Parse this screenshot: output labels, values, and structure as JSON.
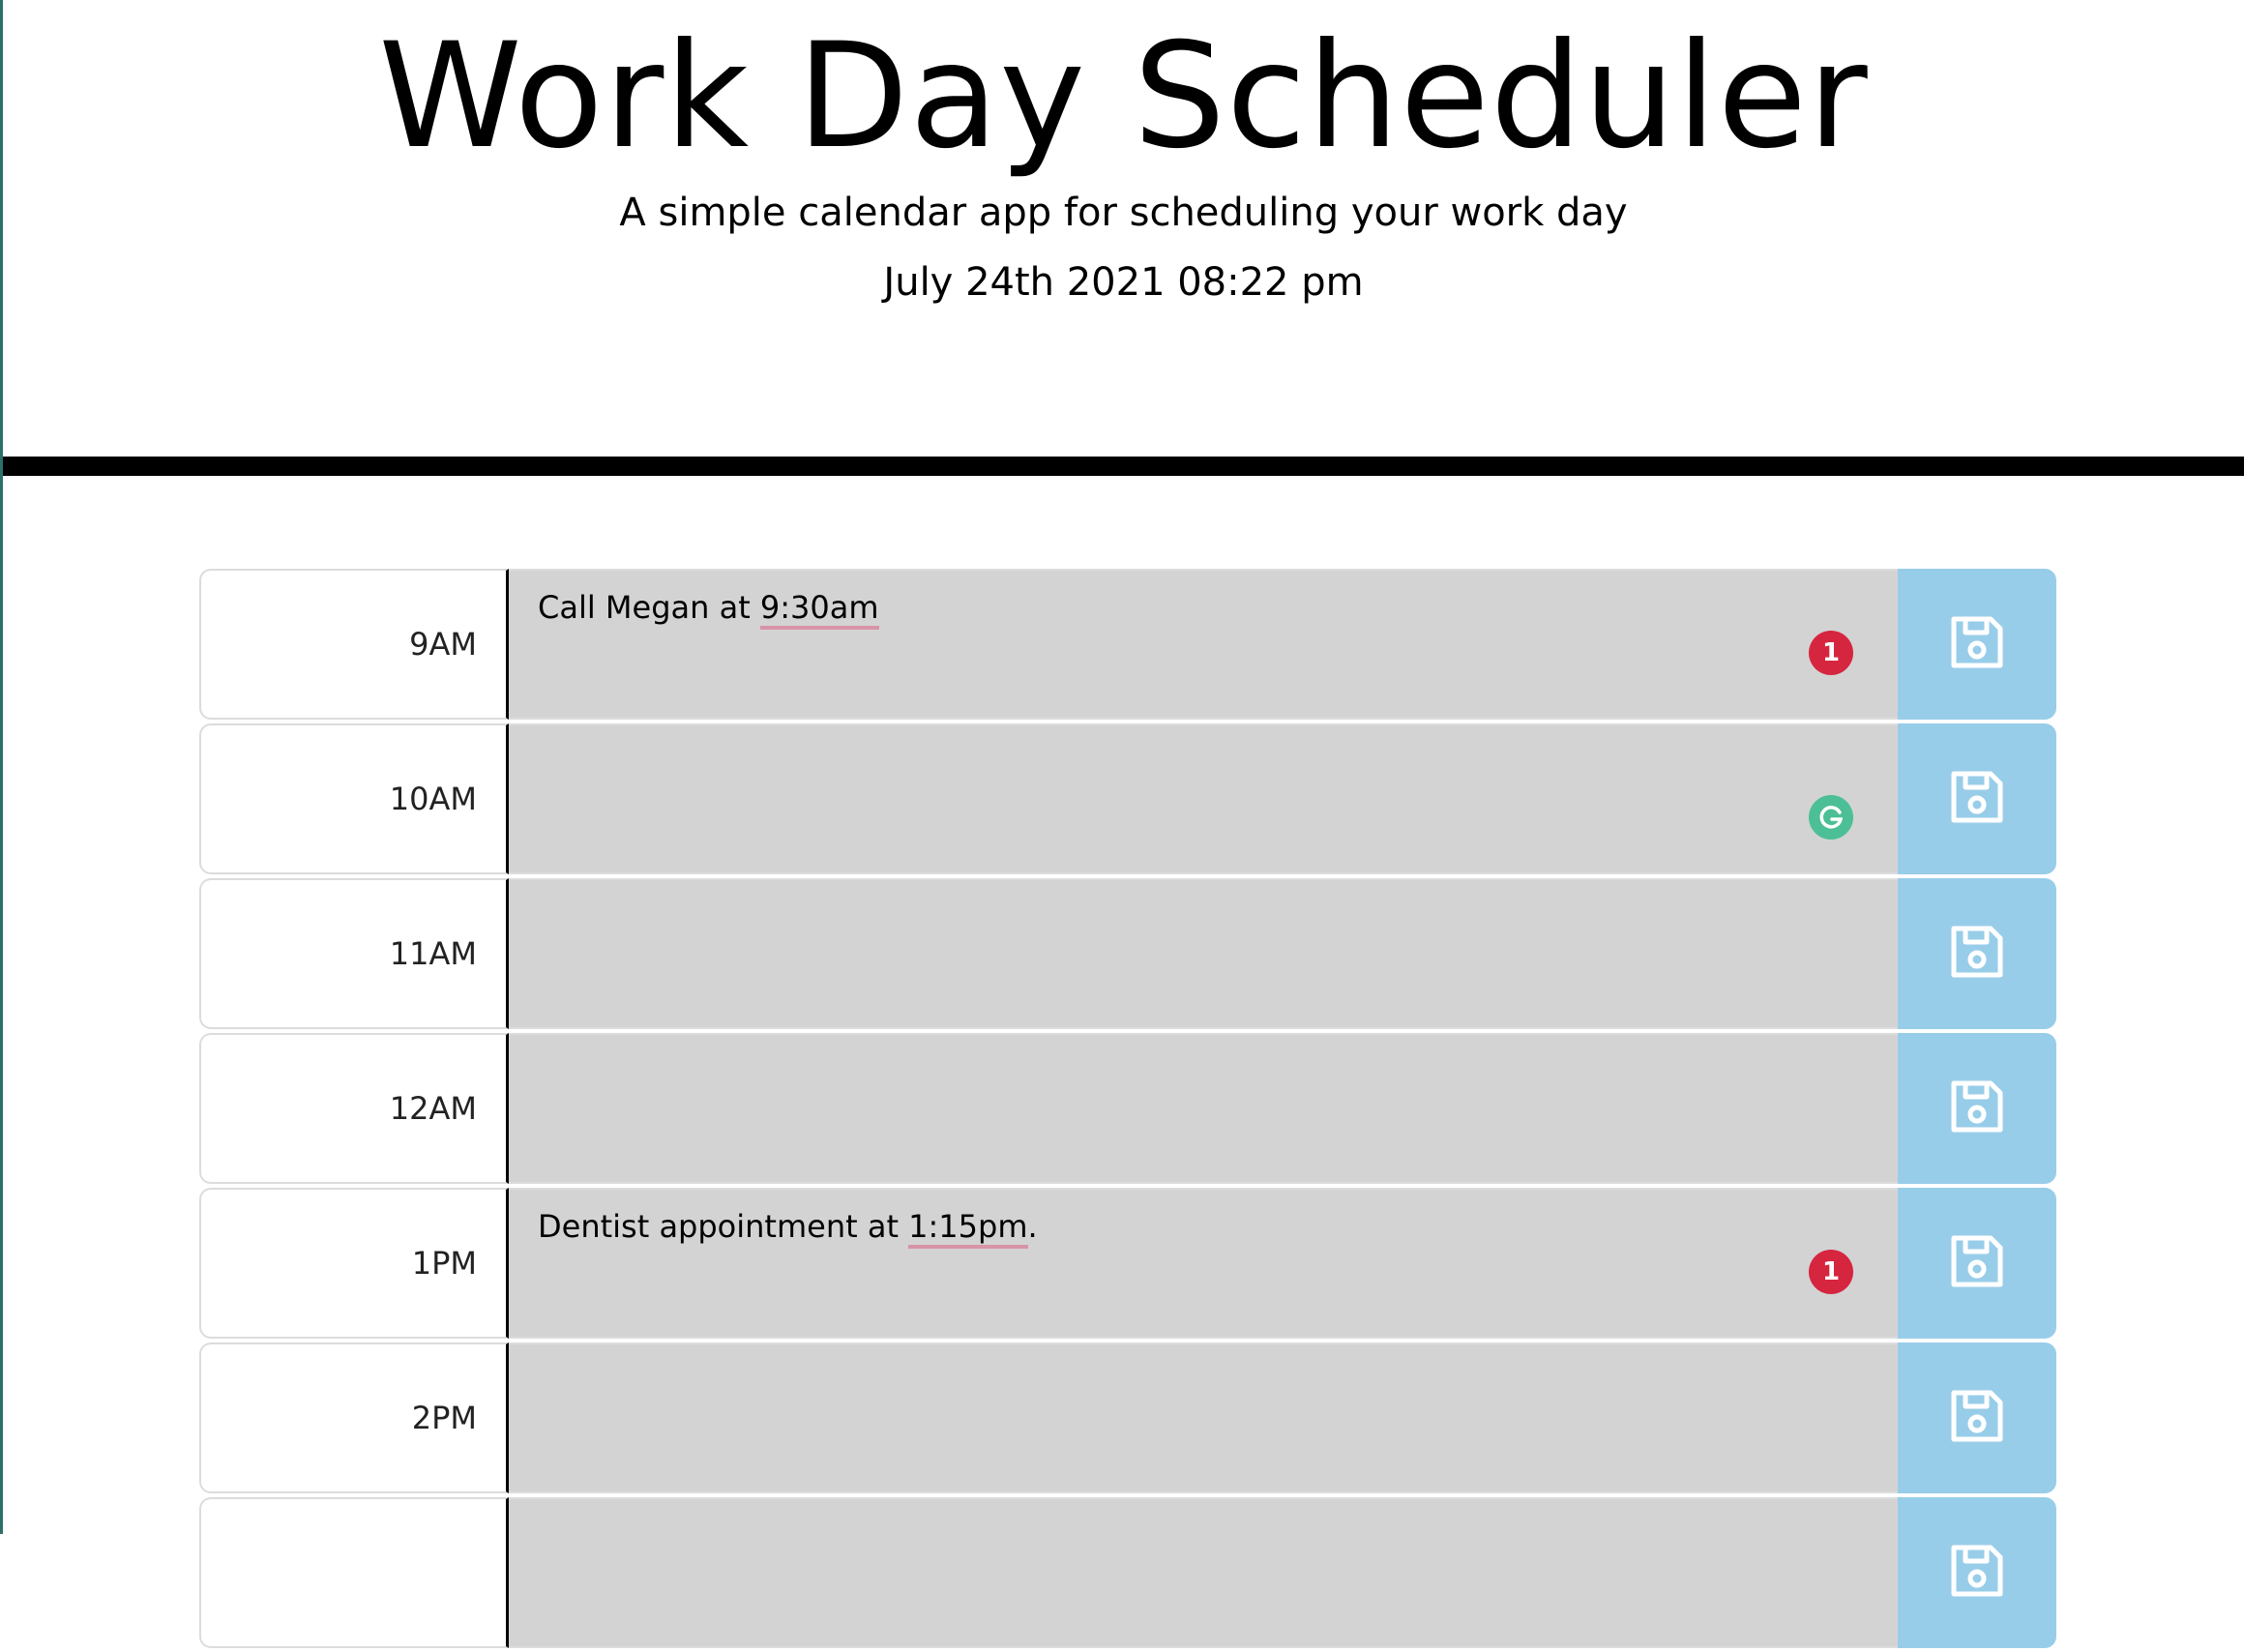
{
  "header": {
    "title": "Work Day Scheduler",
    "subtitle": "A simple calendar app for scheduling your work day",
    "current_datetime": "July 24th 2021 08:22 pm"
  },
  "schedule": {
    "rows": [
      {
        "hour": "9AM",
        "pre": "Call Megan at ",
        "underlined": "9:30am",
        "post": "",
        "badge": "1",
        "grammarly": false
      },
      {
        "hour": "10AM",
        "pre": "",
        "underlined": "",
        "post": "",
        "badge": "",
        "grammarly": true
      },
      {
        "hour": "11AM",
        "pre": "",
        "underlined": "",
        "post": "",
        "badge": "",
        "grammarly": false
      },
      {
        "hour": "12AM",
        "pre": "",
        "underlined": "",
        "post": "",
        "badge": "",
        "grammarly": false
      },
      {
        "hour": "1PM",
        "pre": "Dentist appointment at ",
        "underlined": "1:15pm",
        "post": ".",
        "badge": "1",
        "grammarly": false
      },
      {
        "hour": "2PM",
        "pre": "",
        "underlined": "",
        "post": "",
        "badge": "",
        "grammarly": false
      },
      {
        "hour": "",
        "pre": "",
        "underlined": "",
        "post": "",
        "badge": "",
        "grammarly": false
      }
    ],
    "save_icon": "floppy-disk-icon"
  },
  "colors": {
    "description_bg": "#d3d3d3",
    "save_bg": "#98cde9",
    "badge": "#d6253f",
    "grammarly": "#4cbf97",
    "divider": "#000000"
  }
}
